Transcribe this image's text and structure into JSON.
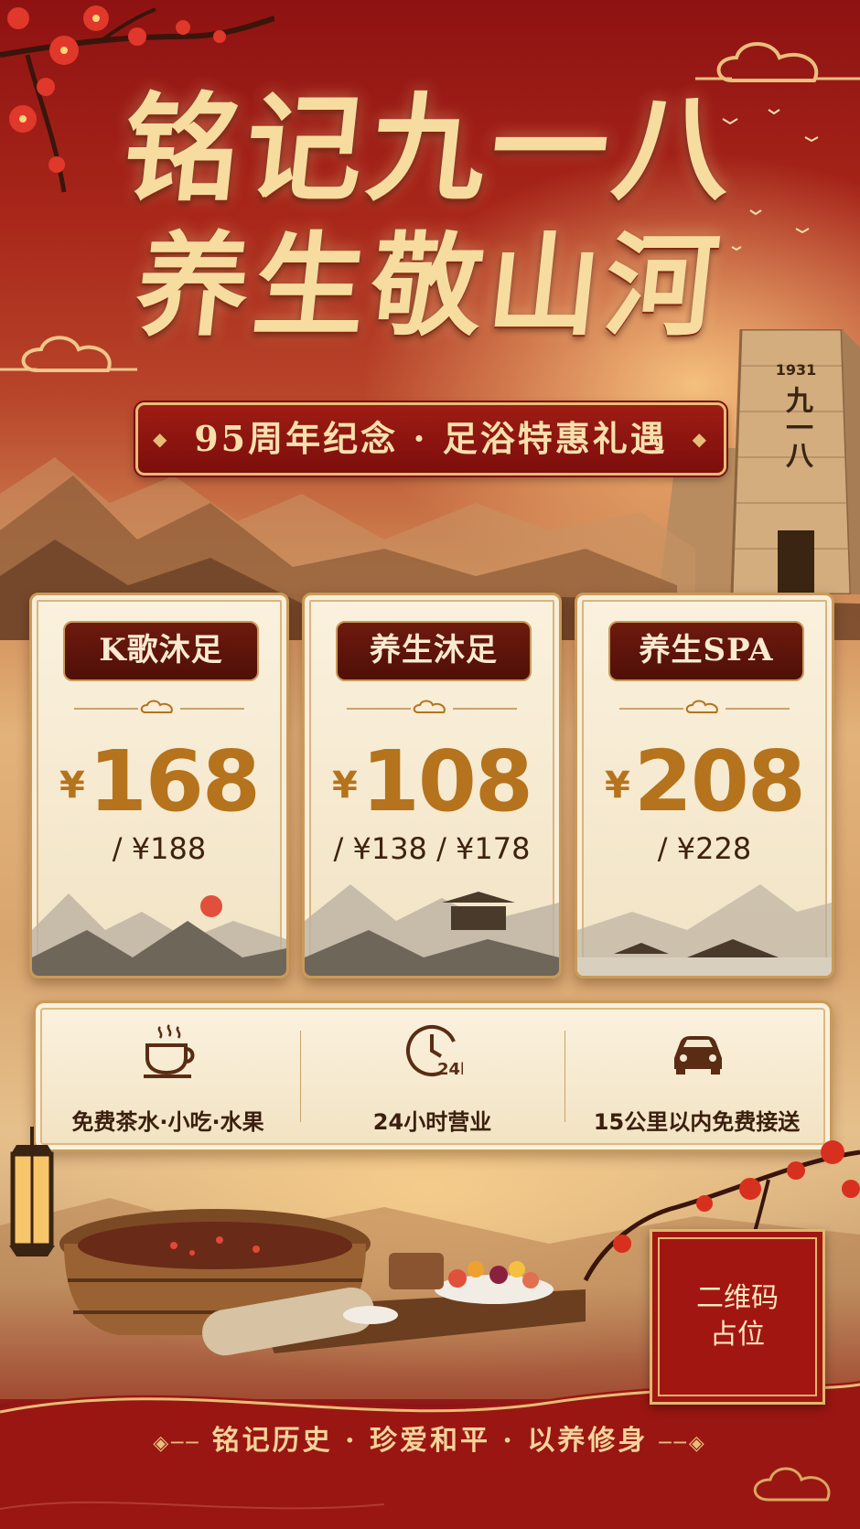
{
  "title": {
    "line1": "铭记九一八",
    "line2": "养生敬山河"
  },
  "banner": {
    "text": "95周年纪念 · 足浴特惠礼遇"
  },
  "monument": {
    "year": "1931",
    "text": "九一八"
  },
  "cards": [
    {
      "name": "K歌沐足",
      "currency": "¥",
      "price": "168",
      "original": "/ ¥188"
    },
    {
      "name": "养生沐足",
      "currency": "¥",
      "price": "108",
      "original": "/ ¥138 / ¥178"
    },
    {
      "name": "养生SPA",
      "currency": "¥",
      "price": "208",
      "original": "/ ¥228"
    }
  ],
  "services": [
    {
      "icon": "tea-cup-icon",
      "label": "免费茶水·小吃·水果"
    },
    {
      "icon": "clock-24h-icon",
      "label": "24小时营业",
      "badge": "24h"
    },
    {
      "icon": "car-icon",
      "label": "15公里以内免费接送"
    }
  ],
  "qr": {
    "line1": "二维码",
    "line2": "占位"
  },
  "slogan": {
    "text": "铭记历史 · 珍爱和平 · 以养修身"
  },
  "colors": {
    "primary_red": "#9e1c14",
    "gold": "#e5bd77",
    "price_gold": "#b4731c",
    "paper": "#faf1de"
  }
}
